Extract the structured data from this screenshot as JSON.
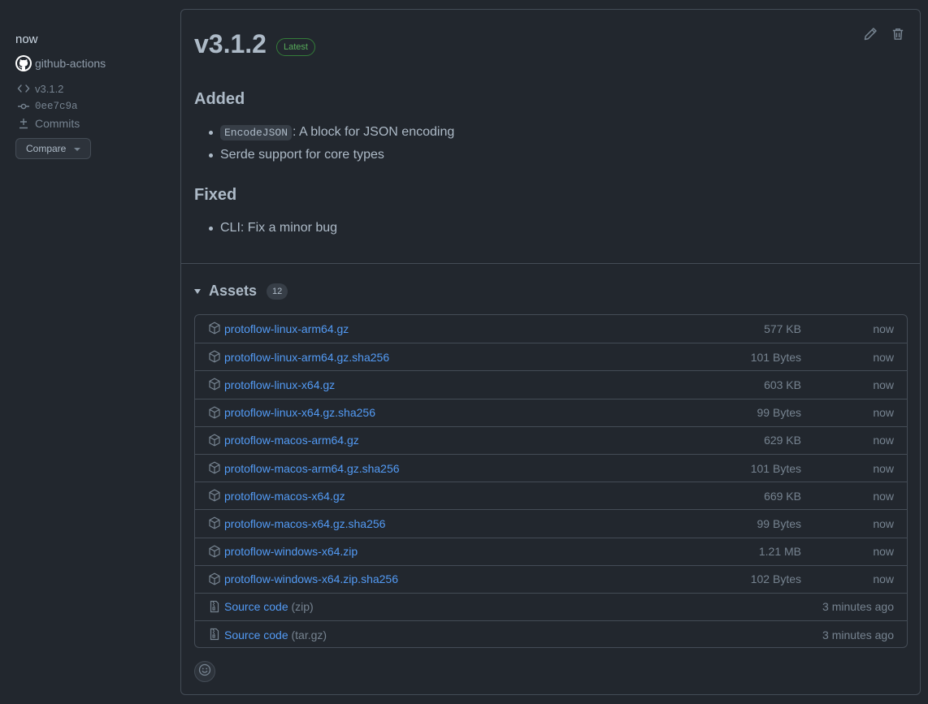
{
  "sidebar": {
    "time": "now",
    "author": "github-actions",
    "tag": "v3.1.2",
    "commit": "0ee7c9a",
    "commits_label": "Commits",
    "compare_label": "Compare"
  },
  "release": {
    "title": "v3.1.2",
    "badge": "Latest",
    "sections": {
      "added": {
        "heading": "Added",
        "item1_code": "EncodeJSON",
        "item1_text": ": A block for JSON encoding",
        "item2": "Serde support for core types"
      },
      "fixed": {
        "heading": "Fixed",
        "item1": "CLI: Fix a minor bug"
      }
    }
  },
  "assets": {
    "title": "Assets",
    "count": "12",
    "items": [
      {
        "name": "protoflow-linux-arm64.gz",
        "size": "577 KB",
        "time": "now"
      },
      {
        "name": "protoflow-linux-arm64.gz.sha256",
        "size": "101 Bytes",
        "time": "now"
      },
      {
        "name": "protoflow-linux-x64.gz",
        "size": "603 KB",
        "time": "now"
      },
      {
        "name": "protoflow-linux-x64.gz.sha256",
        "size": "99 Bytes",
        "time": "now"
      },
      {
        "name": "protoflow-macos-arm64.gz",
        "size": "629 KB",
        "time": "now"
      },
      {
        "name": "protoflow-macos-arm64.gz.sha256",
        "size": "101 Bytes",
        "time": "now"
      },
      {
        "name": "protoflow-macos-x64.gz",
        "size": "669 KB",
        "time": "now"
      },
      {
        "name": "protoflow-macos-x64.gz.sha256",
        "size": "99 Bytes",
        "time": "now"
      },
      {
        "name": "protoflow-windows-x64.zip",
        "size": "1.21 MB",
        "time": "now"
      },
      {
        "name": "protoflow-windows-x64.zip.sha256",
        "size": "102 Bytes",
        "time": "now"
      }
    ],
    "source": [
      {
        "name": "Source code",
        "format": "(zip)",
        "time": "3 minutes ago"
      },
      {
        "name": "Source code",
        "format": "(tar.gz)",
        "time": "3 minutes ago"
      }
    ]
  },
  "colors": {
    "background": "#22272e",
    "link": "#539bf5",
    "badge_green": "#57ab5a",
    "border": "#444c56"
  }
}
